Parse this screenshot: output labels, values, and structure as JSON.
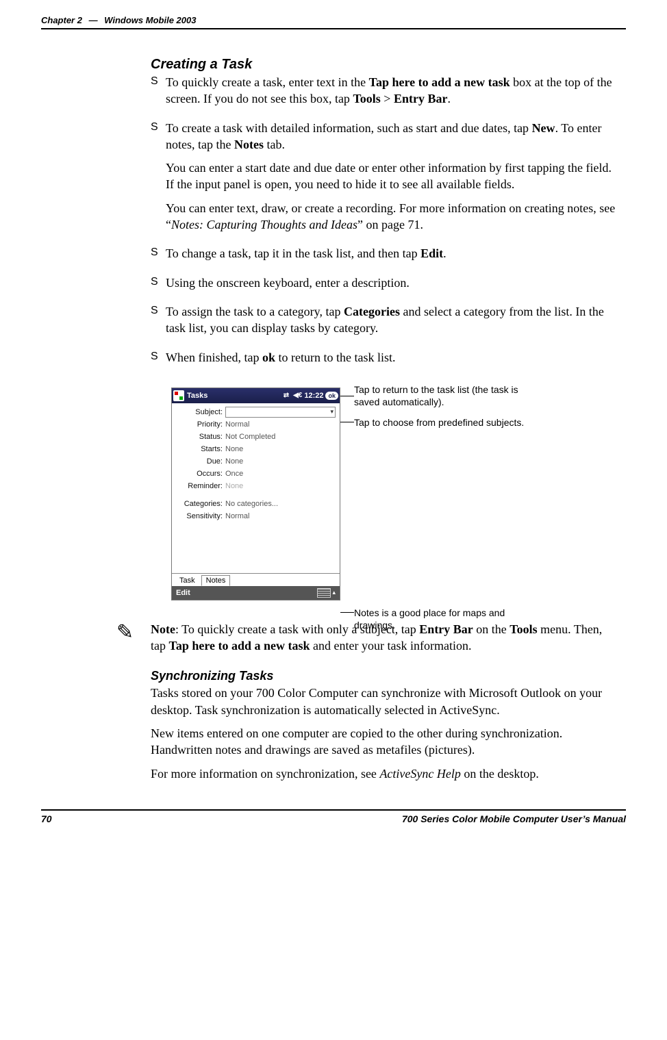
{
  "header": {
    "chapter_label": "Chapter 2",
    "separator": "—",
    "title": "Windows Mobile 2003"
  },
  "section": {
    "creating_task": "Creating a Task",
    "sync_tasks": "Synchronizing Tasks"
  },
  "bullets": {
    "b1_pre": "To quickly create a task, enter text in the ",
    "b1_bold1": "Tap here to add a new task",
    "b1_mid": " box at the top of the screen. If you do not see this box, tap ",
    "b1_bold2": "Tools",
    "b1_gt": " > ",
    "b1_bold3": "Entry Bar",
    "b1_end": ".",
    "b2_pre": "To create a task with detailed information, such as start and due dates, tap ",
    "b2_bold1": "New",
    "b2_mid": ". To enter notes, tap the ",
    "b2_bold2": "Notes",
    "b2_end": " tab.",
    "b2_p2": "You can enter a start date and due date or enter other information by first tapping the field. If the input panel is open, you need to hide it to see all available fields.",
    "b2_p3_pre": "You can enter text, draw, or create a recording. For more information on creating notes, see “",
    "b2_p3_ital": "Notes: Capturing Thoughts and Ideas",
    "b2_p3_post": "” on page 71.",
    "b3_pre": "To change a task, tap it in the task list, and then tap ",
    "b3_bold": "Edit",
    "b3_end": ".",
    "b4": "Using the onscreen keyboard, enter a description.",
    "b5_pre": "To assign the task to a category, tap ",
    "b5_bold": "Categories",
    "b5_post": " and select a category from the list. In the task list, you can display tasks by category.",
    "b6_pre": "When finished, tap ",
    "b6_bold": "ok",
    "b6_post": " to return to the task list."
  },
  "screenshot": {
    "app_title": "Tasks",
    "time": "12:22",
    "ok": "ok",
    "fields": {
      "subject_lbl": "Subject:",
      "priority_lbl": "Priority:",
      "priority_val": "Normal",
      "status_lbl": "Status:",
      "status_val": "Not Completed",
      "starts_lbl": "Starts:",
      "starts_val": "None",
      "due_lbl": "Due:",
      "due_val": "None",
      "occurs_lbl": "Occurs:",
      "occurs_val": "Once",
      "reminder_lbl": "Reminder:",
      "reminder_val": "None",
      "categories_lbl": "Categories:",
      "categories_val": "No categories...",
      "sensitivity_lbl": "Sensitivity:",
      "sensitivity_val": "Normal"
    },
    "tabs": {
      "task": "Task",
      "notes": "Notes"
    },
    "edit_label": "Edit"
  },
  "callouts": {
    "c1": "Tap to return to the task list (the task is saved automatically).",
    "c2": "Tap to choose from predefined subjects.",
    "c3": "Notes is a good place for maps and drawings."
  },
  "note": {
    "pre": "Note",
    "body1": ": To quickly create a task with only a subject, tap ",
    "bold1": "Entry Bar",
    "body2": " on the ",
    "bold2": "Tools",
    "body3": " menu. Then, tap ",
    "bold3": "Tap here to add a new task",
    "body4": " and enter your task information."
  },
  "sync": {
    "p1": "Tasks stored on your 700 Color Computer can synchronize with Microsoft Outlook on your desktop. Task synchronization is automatically selected in ActiveSync.",
    "p2": "New items entered on one computer are copied to the other during synchronization. Handwritten notes and drawings are saved as metafiles (pictures).",
    "p3_pre": "For more information on synchronization, see ",
    "p3_ital": "ActiveSync Help",
    "p3_post": " on the desktop."
  },
  "footer": {
    "page": "70",
    "manual": "700 Series Color Mobile Computer User’s Manual"
  }
}
